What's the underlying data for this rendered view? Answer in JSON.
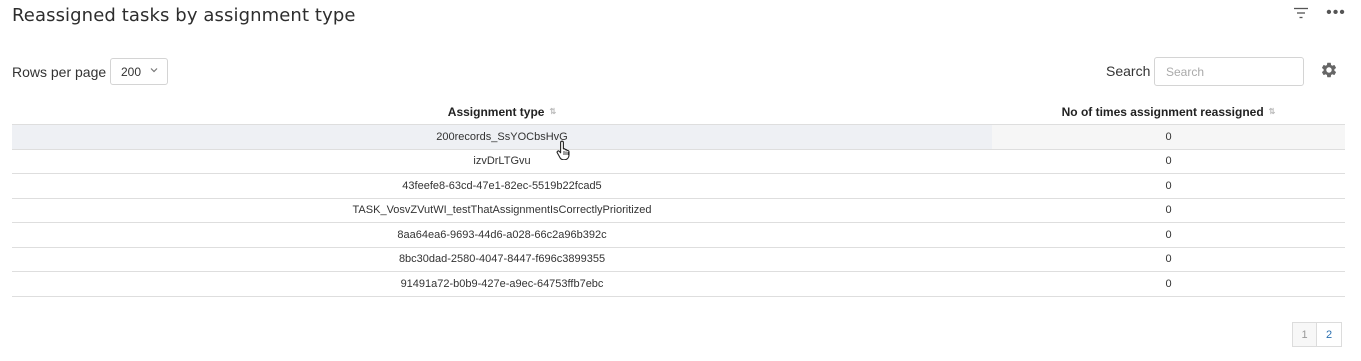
{
  "header": {
    "title": "Reassigned tasks by assignment type",
    "more_glyph": "•••"
  },
  "controls": {
    "rows_per_page_label": "Rows per page",
    "rows_per_page_value": "200",
    "search_label": "Search",
    "search_placeholder": "Search"
  },
  "table": {
    "columns": [
      "Assignment type",
      "No of times assignment reassigned"
    ],
    "rows": [
      {
        "type": "200records_SsYOCbsHvG",
        "count": "0"
      },
      {
        "type": "izvDrLTGvu",
        "count": "0"
      },
      {
        "type": "43feefe8-63cd-47e1-82ec-5519b22fcad5",
        "count": "0"
      },
      {
        "type": "TASK_VosvZVutWI_testThatAssignmentIsCorrectlyPrioritized",
        "count": "0"
      },
      {
        "type": "8aa64ea6-9693-44d6-a028-66c2a96b392c",
        "count": "0"
      },
      {
        "type": "8bc30dad-2580-4047-8447-f696c3899355",
        "count": "0"
      },
      {
        "type": "91491a72-b0b9-427e-a9ec-64753ffb7ebc",
        "count": "0"
      }
    ]
  },
  "pagination": {
    "pages": [
      "1",
      "2"
    ]
  },
  "colors": {
    "row_hover": "#eef0f4",
    "active_page": "#2a6fb0",
    "border": "#dedede"
  }
}
